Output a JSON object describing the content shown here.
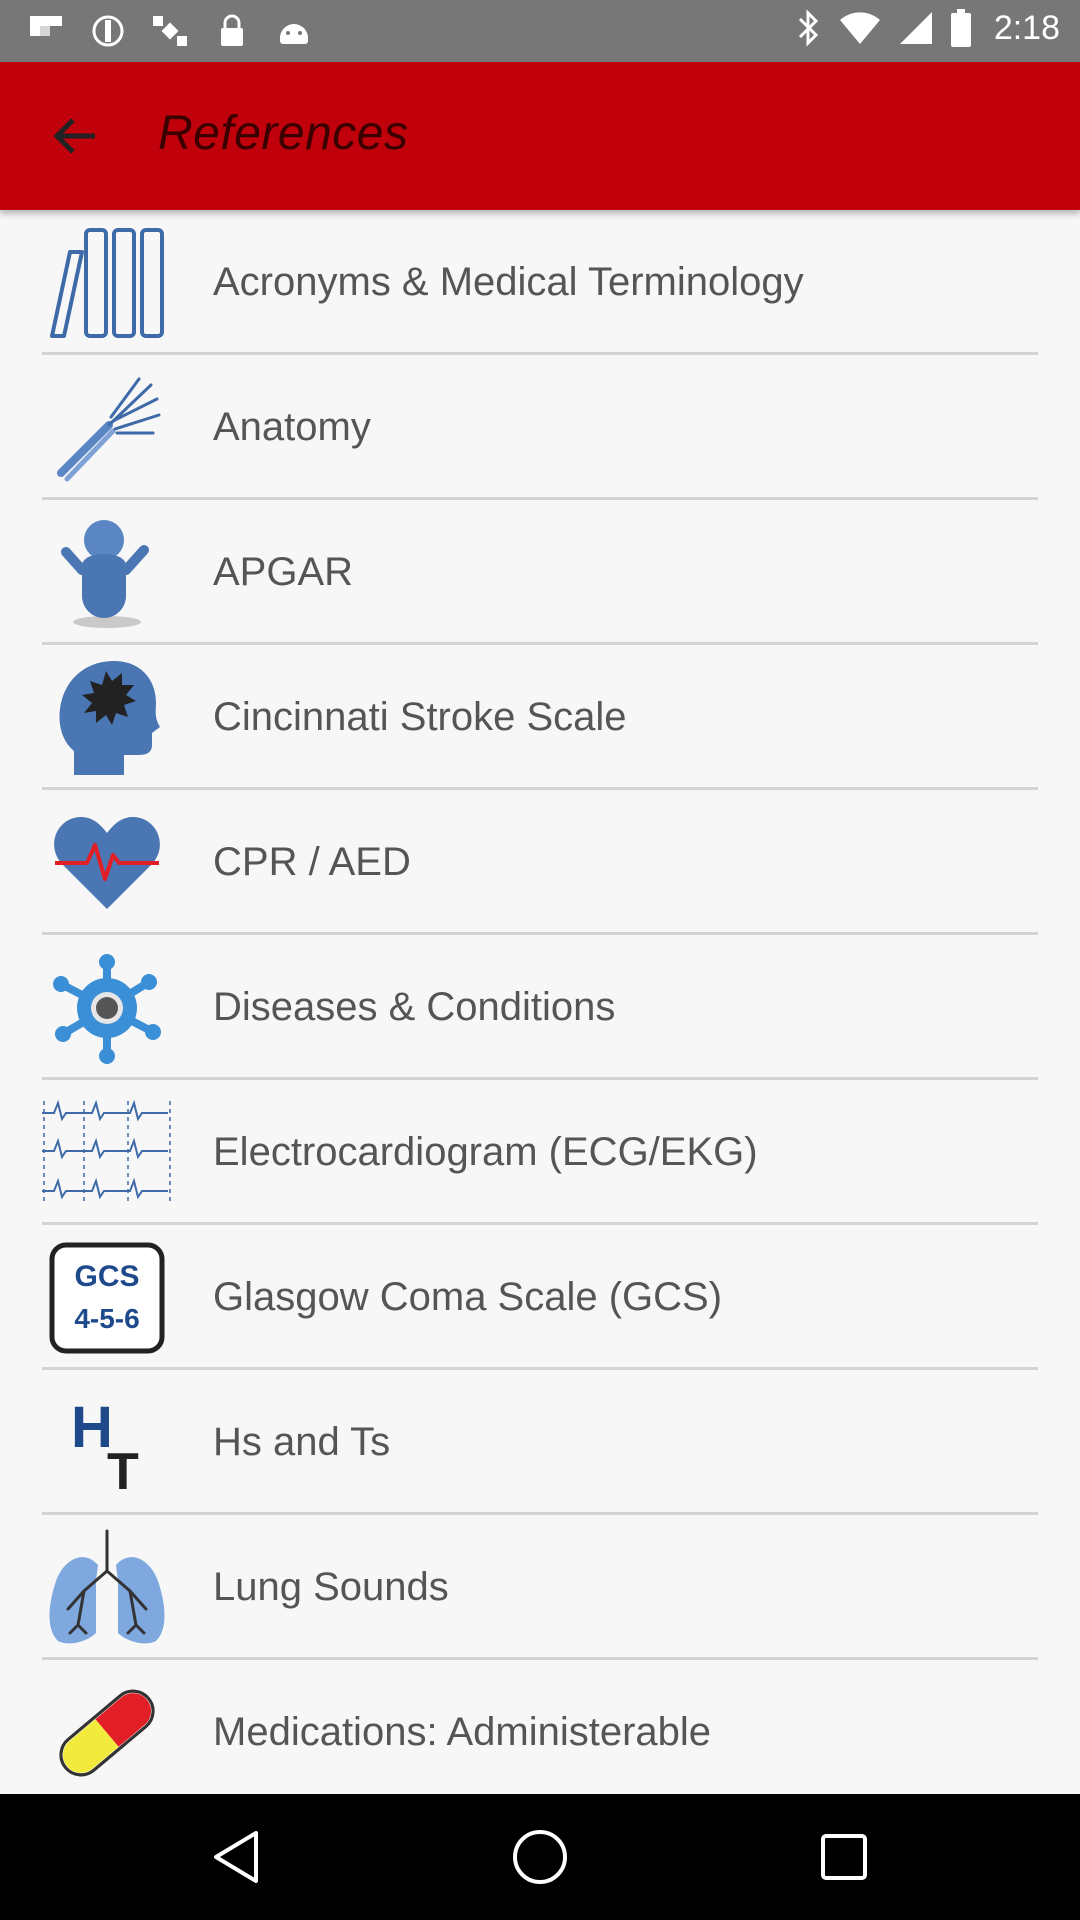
{
  "status_bar": {
    "time": "2:18",
    "left_icons": [
      "flipboard-icon",
      "blocked-icon",
      "satellite-icon",
      "lock-icon",
      "android-icon"
    ],
    "right_icons": [
      "bluetooth-icon",
      "wifi-icon",
      "signal-icon",
      "battery-icon"
    ]
  },
  "app_bar": {
    "title": "References",
    "back_icon": "arrow-back-icon",
    "background": "#c0000a"
  },
  "references": {
    "items": [
      {
        "label": "Acronyms & Medical Terminology",
        "icon": "books-icon"
      },
      {
        "label": "Anatomy",
        "icon": "skeleton-arm-icon"
      },
      {
        "label": "APGAR",
        "icon": "baby-icon"
      },
      {
        "label": "Cincinnati Stroke Scale",
        "icon": "head-stroke-icon"
      },
      {
        "label": "CPR / AED",
        "icon": "heart-pulse-icon"
      },
      {
        "label": "Diseases & Conditions",
        "icon": "virus-icon"
      },
      {
        "label": "Electrocardiogram (ECG/EKG)",
        "icon": "ecg-icon"
      },
      {
        "label": "Glasgow Coma Scale (GCS)",
        "icon": "gcs-badge-icon",
        "badge_line1": "GCS",
        "badge_line2": "4-5-6"
      },
      {
        "label": "Hs and Ts",
        "icon": "hs-ts-icon",
        "glyph_h": "H",
        "glyph_t": "T"
      },
      {
        "label": "Lung Sounds",
        "icon": "lungs-icon"
      },
      {
        "label": "Medications: Administerable",
        "icon": "pill-icon"
      }
    ]
  },
  "nav_bar": {
    "buttons": [
      "back-triangle-icon",
      "home-circle-icon",
      "recents-square-icon"
    ]
  }
}
